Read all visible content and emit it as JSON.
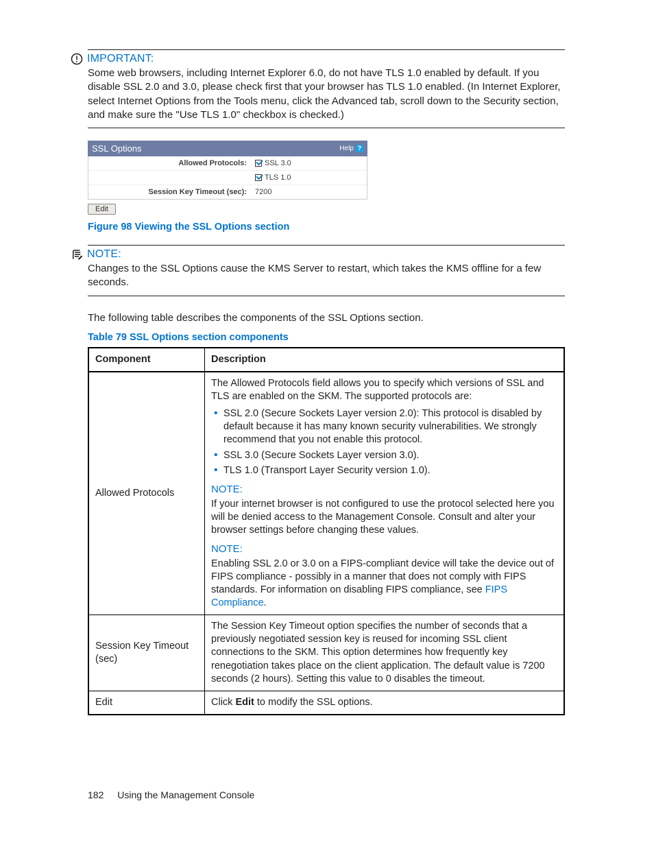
{
  "important": {
    "title": "IMPORTANT:",
    "text": "Some web browsers, including Internet Explorer 6.0, do not have TLS 1.0 enabled by default. If you disable SSL 2.0 and 3.0, please check first that your browser has TLS 1.0 enabled. (In Internet Explorer, select Internet Options from the Tools menu, click the Advanced tab, scroll down to the Security section, and make sure the \"Use TLS 1.0\" checkbox is checked.)"
  },
  "figure": {
    "header": "SSL Options",
    "help": "Help",
    "rows": {
      "allowed_label": "Allowed Protocols:",
      "ssl30": "SSL 3.0",
      "tls10": "TLS 1.0",
      "timeout_label": "Session Key Timeout (sec):",
      "timeout_val": "7200"
    },
    "edit": "Edit",
    "caption": "Figure 98 Viewing the SSL Options section"
  },
  "note": {
    "title": "NOTE:",
    "text": "Changes to the SSL Options cause the KMS Server to restart, which takes the KMS offline for a few seconds."
  },
  "lead": "The following table describes the components of the SSL Options section.",
  "table_caption": "Table 79 SSL Options section components",
  "table": {
    "head_component": "Component",
    "head_description": "Description",
    "row1": {
      "component": "Allowed Protocols",
      "intro": "The Allowed Protocols field allows you to specify which versions of SSL and TLS are enabled on the SKM. The supported protocols are:",
      "b1": "SSL 2.0 (Secure Sockets Layer version 2.0): This protocol is disabled by default because it has many known security vulnerabilities. We strongly recommend that you not enable this protocol.",
      "b2": "SSL 3.0 (Secure Sockets Layer version 3.0).",
      "b3": "TLS 1.0 (Transport Layer Security version 1.0).",
      "note1_title": "NOTE:",
      "note1_text": "If your internet browser is not configured to use the protocol selected here you will be denied access to the Management Console. Consult and alter your browser settings before changing these values.",
      "note2_title": "NOTE:",
      "note2_text_a": "Enabling SSL 2.0 or 3.0 on a FIPS-compliant device will take the device out of FIPS compliance - possibly in a manner that does not comply with FIPS standards. For information on disabling FIPS compliance, see ",
      "note2_link": "FIPS Compliance",
      "note2_text_b": "."
    },
    "row2": {
      "component": "Session Key Timeout (sec)",
      "desc": "The Session Key Timeout option specifies the number of seconds that a previously negotiated session key is reused for incoming SSL client connections to the SKM. This option determines how frequently key renegotiation takes place on the client application. The default value is 7200 seconds (2 hours). Setting this value to 0 disables the timeout."
    },
    "row3": {
      "component": "Edit",
      "desc_a": "Click ",
      "desc_bold": "Edit",
      "desc_b": " to modify the SSL options."
    }
  },
  "footer": {
    "page": "182",
    "section": "Using the Management Console"
  }
}
